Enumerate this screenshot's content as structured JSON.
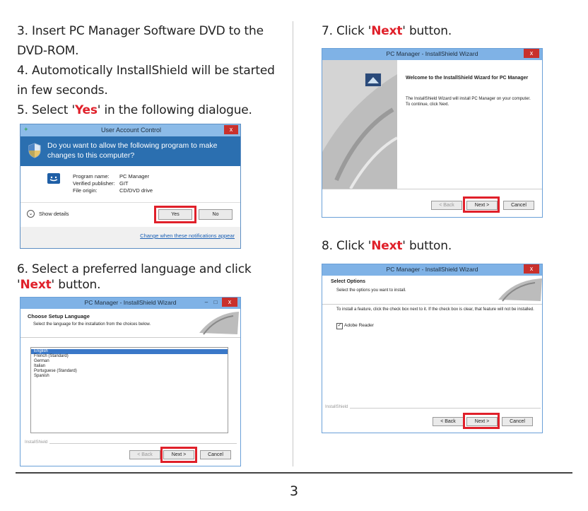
{
  "steps": {
    "s3_line1": "3. Insert PC Manager Software DVD to the",
    "s3_line2": "DVD-ROM.",
    "s4_line1": "4. Automotically InstallShield will be started",
    "s4_line2": "in few seconds.",
    "s5_pre": "5. Select '",
    "s5_em": "Yes",
    "s5_post": "' in the following dialogue.",
    "s6_line1": "6. Select a preferred language and click",
    "s6_pre": "'",
    "s6_em": "Next",
    "s6_post": "' button.",
    "s7_pre": "7. Click '",
    "s7_em": "Next",
    "s7_post": "' button.",
    "s8_pre": "8. Click '",
    "s8_em": "Next",
    "s8_post": "' button."
  },
  "uac": {
    "title": "User Account Control",
    "question_line1": "Do you want to allow the following program to make",
    "question_line2": "changes to this computer?",
    "program_label": "Program name:",
    "program_value": "PC Manager",
    "publisher_label": "Verified publisher:",
    "publisher_value": "GIT",
    "origin_label": "File origin:",
    "origin_value": "CD/DVD drive",
    "show_details": "Show details",
    "yes": "Yes",
    "no": "No",
    "change_link": "Change when these notifications appear",
    "close": "x"
  },
  "lang_wizard": {
    "title": "PC Manager - InstallShield Wizard",
    "heading": "Choose Setup Language",
    "subheading": "Select the language for the installation from the choices below.",
    "languages": [
      "English",
      "French (Standard)",
      "German",
      "Italian",
      "Portuguese (Standard)",
      "Spanish"
    ],
    "footer_brand": "InstallShield",
    "back": "< Back",
    "next": "Next >",
    "cancel": "Cancel",
    "close": "x",
    "minimize": "–",
    "maximize": "□"
  },
  "welcome_wizard": {
    "title": "PC Manager - InstallShield Wizard",
    "heading": "Welcome to the InstallShield Wizard for PC Manager",
    "body": "The InstallShield Wizard will install PC Manager on your computer.  To continue, click Next.",
    "back": "< Back",
    "next": "Next >",
    "cancel": "Cancel",
    "close": "x"
  },
  "options_wizard": {
    "title": "PC Manager - InstallShield Wizard",
    "heading": "Select Options",
    "subheading": "Select the options you want to install.",
    "instruction": "To install a feature, click the check box next to it.  If the check box is clear, that feature will not be installed.",
    "option_label": "Adobe Reader",
    "footer_brand": "InstallShield",
    "back": "< Back",
    "next": "Next >",
    "cancel": "Cancel",
    "close": "x"
  },
  "page_number": "3",
  "colors": {
    "accent_red": "#e0202a",
    "titlebar": "#7fb2e6",
    "uac_header": "#2b6fb0"
  }
}
